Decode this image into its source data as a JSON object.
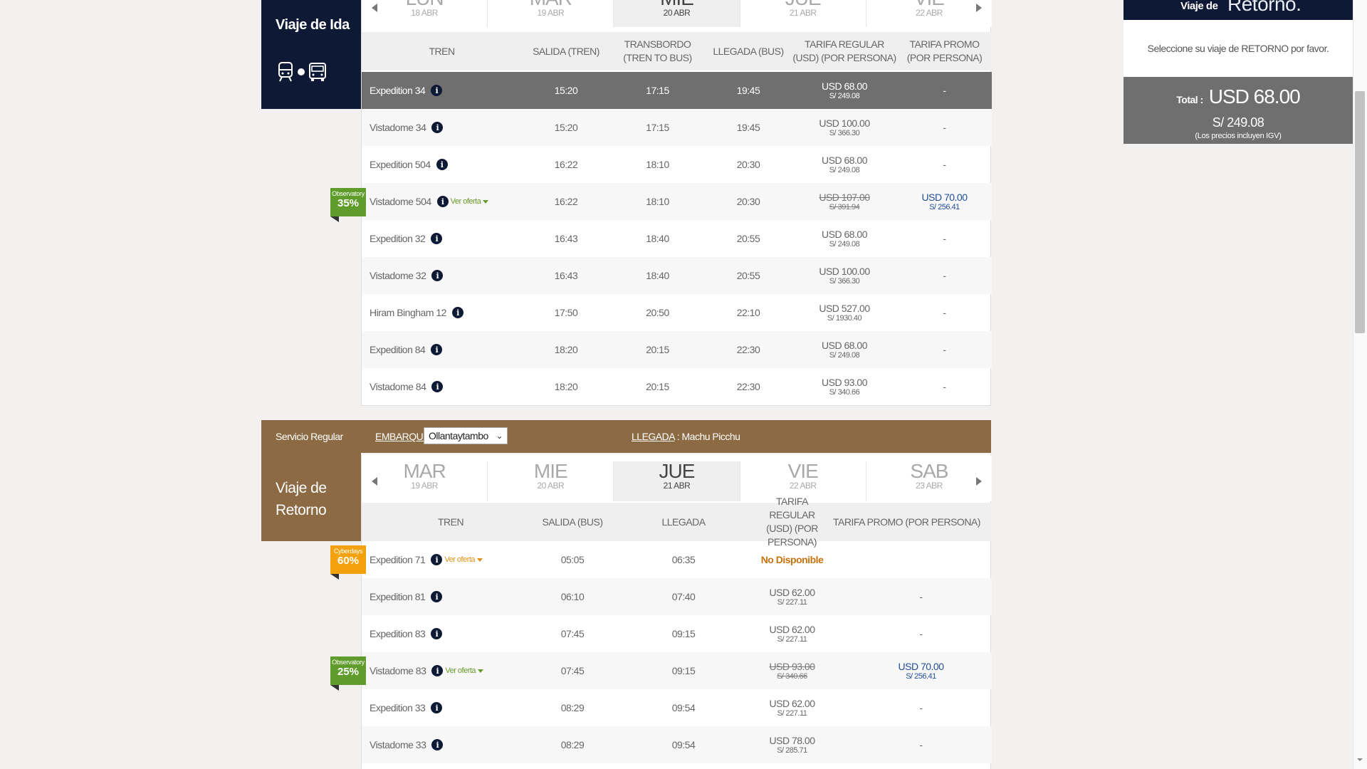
{
  "ida": {
    "side_title": "Viaje de Ida",
    "dates": [
      {
        "day": "LUN",
        "date": "18 ABR"
      },
      {
        "day": "MAR",
        "date": "19 ABR"
      },
      {
        "day": "MIE",
        "date": "20 ABR"
      },
      {
        "day": "JUE",
        "date": "21 ABR"
      },
      {
        "day": "VIE",
        "date": "22 ABR"
      }
    ],
    "columns": [
      "TREN",
      "SALIDA (TREN)",
      "TRANSBORDO (TREN TO BUS)",
      "LLEGADA (BUS)",
      "TARIFA REGULAR (USD) (POR PERSONA)",
      "TARIFA PROMO (POR PERSONA)"
    ],
    "rows": [
      {
        "name": "Expedition 34",
        "salida": "15:20",
        "transbordo": "17:15",
        "llegada": "19:45",
        "usd": "USD 68.00",
        "pen": "S/ 249.08",
        "promo": "-"
      },
      {
        "name": "Vistadome 34",
        "salida": "15:20",
        "transbordo": "17:15",
        "llegada": "19:45",
        "usd": "USD 100.00",
        "pen": "S/ 366.30",
        "promo": "-"
      },
      {
        "name": "Expedition 504",
        "salida": "16:22",
        "transbordo": "18:10",
        "llegada": "20:30",
        "usd": "USD 68.00",
        "pen": "S/ 249.08",
        "promo": "-"
      },
      {
        "name": "Vistadome 504",
        "oferta": "Ver oferta",
        "badge_top": "Observatory",
        "badge_pct": "35%",
        "salida": "16:22",
        "transbordo": "18:10",
        "llegada": "20:30",
        "usd": "USD 107.00",
        "pen": "S/ 391.94",
        "promo_usd": "USD 70.00",
        "promo_pen": "S/ 256.41"
      },
      {
        "name": "Expedition 32",
        "salida": "16:43",
        "transbordo": "18:40",
        "llegada": "20:55",
        "usd": "USD 68.00",
        "pen": "S/ 249.08",
        "promo": "-"
      },
      {
        "name": "Vistadome 32",
        "salida": "16:43",
        "transbordo": "18:40",
        "llegada": "20:55",
        "usd": "USD 100.00",
        "pen": "S/ 366.30",
        "promo": "-"
      },
      {
        "name": "Hiram Bingham 12",
        "salida": "17:50",
        "transbordo": "20:50",
        "llegada": "22:10",
        "usd": "USD 527.00",
        "pen": "S/ 1930.40",
        "promo": "-"
      },
      {
        "name": "Expedition 84",
        "salida": "18:20",
        "transbordo": "20:15",
        "llegada": "22:30",
        "usd": "USD 68.00",
        "pen": "S/ 249.08",
        "promo": "-"
      },
      {
        "name": "Vistadome 84",
        "salida": "18:20",
        "transbordo": "20:15",
        "llegada": "22:30",
        "usd": "USD 93.00",
        "pen": "S/ 340.66",
        "promo": "-"
      }
    ]
  },
  "ret_bar": {
    "service": "Servicio Regular",
    "embarque_label": "EMBARQUE",
    "embarque_value": "Ollantaytambo",
    "llegada_label": "LLEGADA",
    "llegada_value": "Machu Picchu"
  },
  "ret": {
    "side_title_1": "Viaje de",
    "side_title_2": "Retorno",
    "dates": [
      {
        "day": "MAR",
        "date": "19 ABR"
      },
      {
        "day": "MIE",
        "date": "20 ABR"
      },
      {
        "day": "JUE",
        "date": "21 ABR"
      },
      {
        "day": "VIE",
        "date": "22 ABR"
      },
      {
        "day": "SAB",
        "date": "23 ABR"
      }
    ],
    "columns": [
      "TREN",
      "SALIDA (BUS)",
      "LLEGADA",
      "TARIFA REGULAR (USD) (POR PERSONA)",
      "TARIFA PROMO (POR PERSONA)"
    ],
    "rows": [
      {
        "name": "Expedition 71",
        "oferta": "Ver oferta",
        "badge_top": "Cyberdays",
        "badge_pct": "60%",
        "salida": "05:05",
        "llegada": "06:35",
        "nodisp": "No Disponible"
      },
      {
        "name": "Expedition 81",
        "salida": "06:10",
        "llegada": "07:40",
        "usd": "USD 62.00",
        "pen": "S/ 227.11",
        "promo": "-"
      },
      {
        "name": "Expedition 83",
        "salida": "07:45",
        "llegada": "09:15",
        "usd": "USD 62.00",
        "pen": "S/ 227.11",
        "promo": "-"
      },
      {
        "name": "Vistadome 83",
        "oferta": "Ver oferta",
        "badge_top": "Observatory",
        "badge_pct": "25%",
        "salida": "07:45",
        "llegada": "09:15",
        "usd": "USD 93.00",
        "pen": "S/ 340.66",
        "promo_usd": "USD 70.00",
        "promo_pen": "S/ 256.41"
      },
      {
        "name": "Expedition 33",
        "salida": "08:29",
        "llegada": "09:54",
        "usd": "USD 62.00",
        "pen": "S/ 227.11",
        "promo": "-"
      },
      {
        "name": "Vistadome 33",
        "salida": "08:29",
        "llegada": "09:54",
        "usd": "USD 78.00",
        "pen": "S/ 285.71",
        "promo": "-"
      }
    ]
  },
  "summary": {
    "head_1": "Viaje de",
    "head_2": "Retorno.",
    "message": "Seleccione su viaje de RETORNO por favor.",
    "total_label": "Total :",
    "total_usd": "USD 68.00",
    "total_pen": "S/ 249.08",
    "igv_note": "(Los precios incluyen IGV)"
  },
  "colors": {
    "navy": "#0e1a35",
    "brown": "#8c6a44",
    "green_badge": "#5f9c2b",
    "orange_badge": "#f4a10e",
    "promo_blue": "#1f4e9a"
  }
}
